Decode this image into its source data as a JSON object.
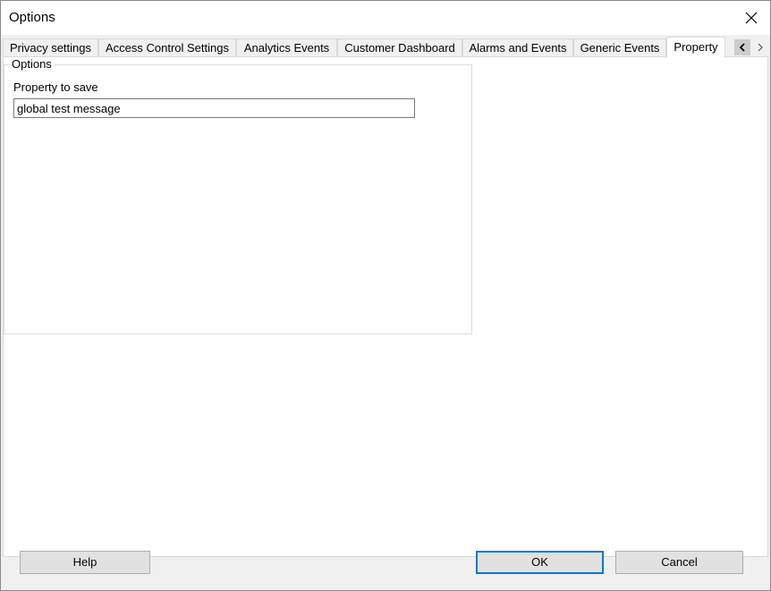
{
  "window": {
    "title": "Options"
  },
  "tabs": [
    {
      "label": "Privacy settings"
    },
    {
      "label": "Access Control Settings"
    },
    {
      "label": "Analytics Events"
    },
    {
      "label": "Customer Dashboard"
    },
    {
      "label": "Alarms and Events"
    },
    {
      "label": "Generic Events"
    },
    {
      "label": "Property",
      "active": true
    }
  ],
  "panel": {
    "group_title": "Options",
    "field_label": "Property to save",
    "field_value": "global test message"
  },
  "buttons": {
    "help": "Help",
    "ok": "OK",
    "cancel": "Cancel"
  },
  "icons": {
    "close": "close-icon",
    "scroll_left": "chevron-left-icon",
    "scroll_right": "chevron-right-icon"
  },
  "colors": {
    "default_button_border": "#0078d7",
    "dialog_background": "#f0f0f0"
  }
}
